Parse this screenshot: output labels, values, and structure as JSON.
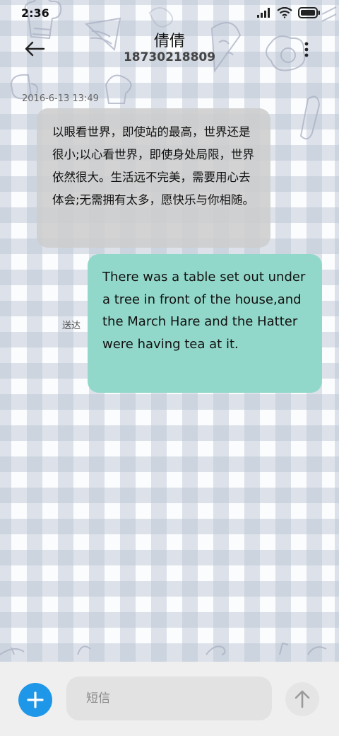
{
  "status_bar": {
    "time": "2:36",
    "icons": [
      "signal-icon",
      "wifi-icon",
      "battery-icon"
    ]
  },
  "header": {
    "contact_name": "倩倩",
    "contact_number": "18730218809",
    "back_icon": "back-arrow-icon",
    "more_icon": "more-vertical-icon"
  },
  "conversation": {
    "timestamp": "2016-6-13 13:49",
    "messages": [
      {
        "direction": "incoming",
        "text": "以眼看世界，即使站的最高，世界还是很小;以心看世界，即使身处局限，世界依然很大。生活远不完美，需要用心去体会;无需拥有太多，愿快乐与你相随。"
      },
      {
        "direction": "outgoing",
        "text": "There was a table set out under a tree in front of the house,and the March Hare and the Hatter were having tea at it.",
        "status": "送达"
      }
    ]
  },
  "composer": {
    "add_icon": "plus-icon",
    "placeholder": "短信",
    "send_icon": "arrow-up-icon"
  },
  "colors": {
    "outgoing_bubble": "#92d8ca",
    "incoming_bubble": "#cdcdcd",
    "add_button": "#1f97e8"
  }
}
